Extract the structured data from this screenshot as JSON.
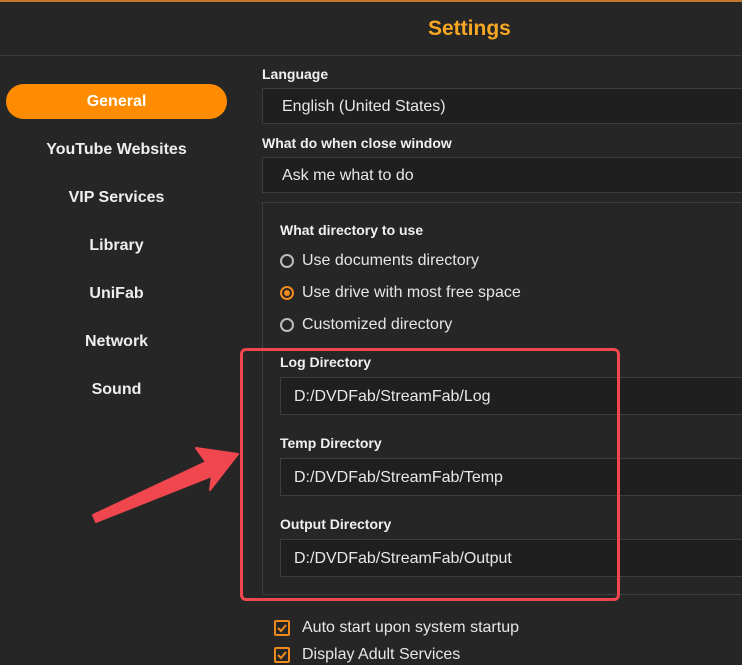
{
  "window": {
    "title": "Settings",
    "accent_color": "#ff8c00",
    "title_color": "#f5a623",
    "annotation_color": "#f0474e"
  },
  "sidebar": {
    "items": [
      {
        "label": "General",
        "active": true
      },
      {
        "label": "YouTube Websites",
        "active": false
      },
      {
        "label": "VIP Services",
        "active": false
      },
      {
        "label": "Library",
        "active": false
      },
      {
        "label": "UniFab",
        "active": false
      },
      {
        "label": "Network",
        "active": false
      },
      {
        "label": "Sound",
        "active": false
      }
    ]
  },
  "general": {
    "language": {
      "label": "Language",
      "value": "English (United States)"
    },
    "close_window": {
      "label": "What do when close window",
      "value": "Ask me what to do"
    },
    "directory": {
      "label": "What directory to use",
      "options": [
        {
          "label": "Use documents directory",
          "checked": false
        },
        {
          "label": "Use drive with most free space",
          "checked": true
        },
        {
          "label": "Customized directory",
          "checked": false
        }
      ]
    },
    "log_directory": {
      "label": "Log Directory",
      "value": "D:/DVDFab/StreamFab/Log"
    },
    "temp_directory": {
      "label": "Temp Directory",
      "value": "D:/DVDFab/StreamFab/Temp"
    },
    "output_directory": {
      "label": "Output Directory",
      "value": "D:/DVDFab/StreamFab/Output"
    },
    "checkboxes": [
      {
        "label": "Auto start upon system startup",
        "checked": true
      },
      {
        "label": "Display Adult Services",
        "checked": true
      }
    ]
  }
}
